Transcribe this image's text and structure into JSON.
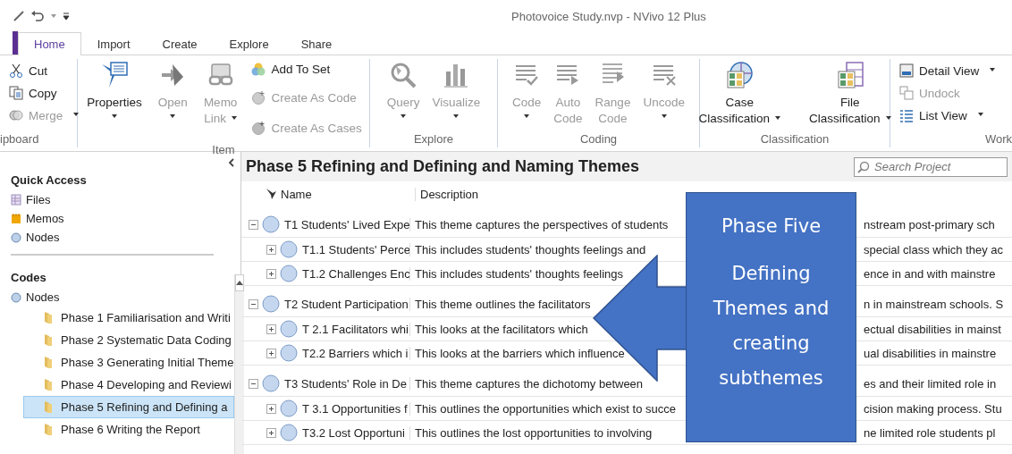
{
  "window": {
    "title": "Photovoice Study.nvp - NVivo 12 Plus"
  },
  "tabs": [
    {
      "label": "Home",
      "selected": true
    },
    {
      "label": "Import",
      "selected": false
    },
    {
      "label": "Create",
      "selected": false
    },
    {
      "label": "Explore",
      "selected": false
    },
    {
      "label": "Share",
      "selected": false
    }
  ],
  "ribbon": [
    {
      "label": "ipboard",
      "buttons": [
        {
          "kind": "small",
          "lines": [
            "Cut"
          ],
          "disabled": false,
          "dropdown": false
        },
        {
          "kind": "small",
          "lines": [
            "Copy"
          ],
          "disabled": false,
          "dropdown": false
        },
        {
          "kind": "small",
          "lines": [
            "Merge"
          ],
          "disabled": true,
          "dropdown": true
        }
      ]
    },
    {
      "label": "Item",
      "buttons": [
        {
          "kind": "large",
          "lines": [
            "Properties"
          ],
          "disabled": false,
          "dropdown": true
        },
        {
          "kind": "large",
          "lines": [
            "Open"
          ],
          "disabled": true,
          "dropdown": true
        },
        {
          "kind": "large",
          "lines": [
            "Memo",
            "Link"
          ],
          "disabled": true,
          "dropdown": true
        },
        {
          "kind": "small",
          "lines": [
            "Add To Set"
          ],
          "disabled": false,
          "dropdown": false
        },
        {
          "kind": "small",
          "lines": [
            "Create As Code"
          ],
          "disabled": true,
          "dropdown": false
        },
        {
          "kind": "small",
          "lines": [
            "Create As Cases"
          ],
          "disabled": true,
          "dropdown": false
        }
      ]
    },
    {
      "label": "Explore",
      "buttons": [
        {
          "kind": "large",
          "lines": [
            "Query"
          ],
          "disabled": true,
          "dropdown": true
        },
        {
          "kind": "large",
          "lines": [
            "Visualize"
          ],
          "disabled": true,
          "dropdown": true
        }
      ]
    },
    {
      "label": "Coding",
      "buttons": [
        {
          "kind": "large",
          "lines": [
            "Code"
          ],
          "disabled": true,
          "dropdown": true
        },
        {
          "kind": "large",
          "lines": [
            "Auto",
            "Code"
          ],
          "disabled": true,
          "dropdown": false
        },
        {
          "kind": "large",
          "lines": [
            "Range",
            "Code"
          ],
          "disabled": true,
          "dropdown": false
        },
        {
          "kind": "large",
          "lines": [
            "Uncode"
          ],
          "disabled": true,
          "dropdown": true
        }
      ]
    },
    {
      "label": "Classification",
      "buttons": [
        {
          "kind": "large",
          "lines": [
            "Case",
            "Classification"
          ],
          "disabled": false,
          "dropdown": true
        },
        {
          "kind": "large",
          "lines": [
            "File",
            "Classification"
          ],
          "disabled": false,
          "dropdown": true
        }
      ]
    },
    {
      "label": "Work",
      "buttons": [
        {
          "kind": "small",
          "lines": [
            "Detail View"
          ],
          "disabled": false,
          "dropdown": true
        },
        {
          "kind": "small",
          "lines": [
            "Undock"
          ],
          "disabled": true,
          "dropdown": false
        },
        {
          "kind": "small",
          "lines": [
            "List View"
          ],
          "disabled": false,
          "dropdown": true
        }
      ]
    }
  ],
  "navigation": {
    "quick_access": {
      "title": "Quick Access",
      "items": [
        "Files",
        "Memos",
        "Nodes"
      ]
    },
    "codes": {
      "title": "Codes",
      "root": "Nodes",
      "folders": [
        {
          "label": "Phase 1 Familiarisation and Writi",
          "selected": false
        },
        {
          "label": "Phase 2 Systematic Data Coding",
          "selected": false
        },
        {
          "label": "Phase 3 Generating Initial Theme",
          "selected": false
        },
        {
          "label": "Phase 4 Developing and Reviewi",
          "selected": false
        },
        {
          "label": "Phase 5 Refining and Defining a",
          "selected": true
        },
        {
          "label": "Phase 6 Writing the Report",
          "selected": false
        }
      ]
    }
  },
  "content": {
    "title": "Phase 5 Refining and Defining and Naming Themes",
    "search": {
      "placeholder": "Search Project"
    },
    "columns": [
      "Name",
      "Description"
    ],
    "themes": [
      {
        "name": "T1 Students' Lived Expe",
        "description_start": "This theme captures the perspectives of students",
        "description_end": "nstream post-primary sch",
        "expanded": true,
        "children": [
          {
            "name": "T1.1 Students' Perce",
            "description_start": "This includes students' thoughts feelings and",
            "description_end": "special class which they ac",
            "expanded": false
          },
          {
            "name": "T1.2 Challenges Enc",
            "description_start": "This includes students' thoughts feelings",
            "description_end": "ence in and with mainstre",
            "expanded": false
          }
        ]
      },
      {
        "name": "T2 Student Participation",
        "description_start": "This theme outlines the facilitators",
        "description_end": "n in mainstream schools. S",
        "expanded": true,
        "children": [
          {
            "name": "T 2.1 Facilitators whi",
            "description_start": "This looks at the facilitators which",
            "description_end": "ectual disabilities in mainst",
            "expanded": false
          },
          {
            "name": "T2.2 Barriers which i",
            "description_start": "This looks at the barriers which influence",
            "description_end": "ual disabilities in mainstre",
            "expanded": false
          }
        ]
      },
      {
        "name": "T3 Students' Role in De",
        "description_start": "This theme captures the dichotomy between",
        "description_end": "es and their limited role in",
        "expanded": true,
        "children": [
          {
            "name": "T 3.1 Opportunities f",
            "description_start": "This outlines the opportunities which exist to succe",
            "description_end": "cision making process. Stu",
            "expanded": false
          },
          {
            "name": "T3.2 Lost Opportuni",
            "description_start": "This outlines the lost opportunities to involving",
            "description_end": "ne limited role students pl",
            "expanded": false
          }
        ]
      }
    ]
  },
  "callout": {
    "heading": "Phase Five",
    "text": "Defining Themes and creating subthemes"
  }
}
